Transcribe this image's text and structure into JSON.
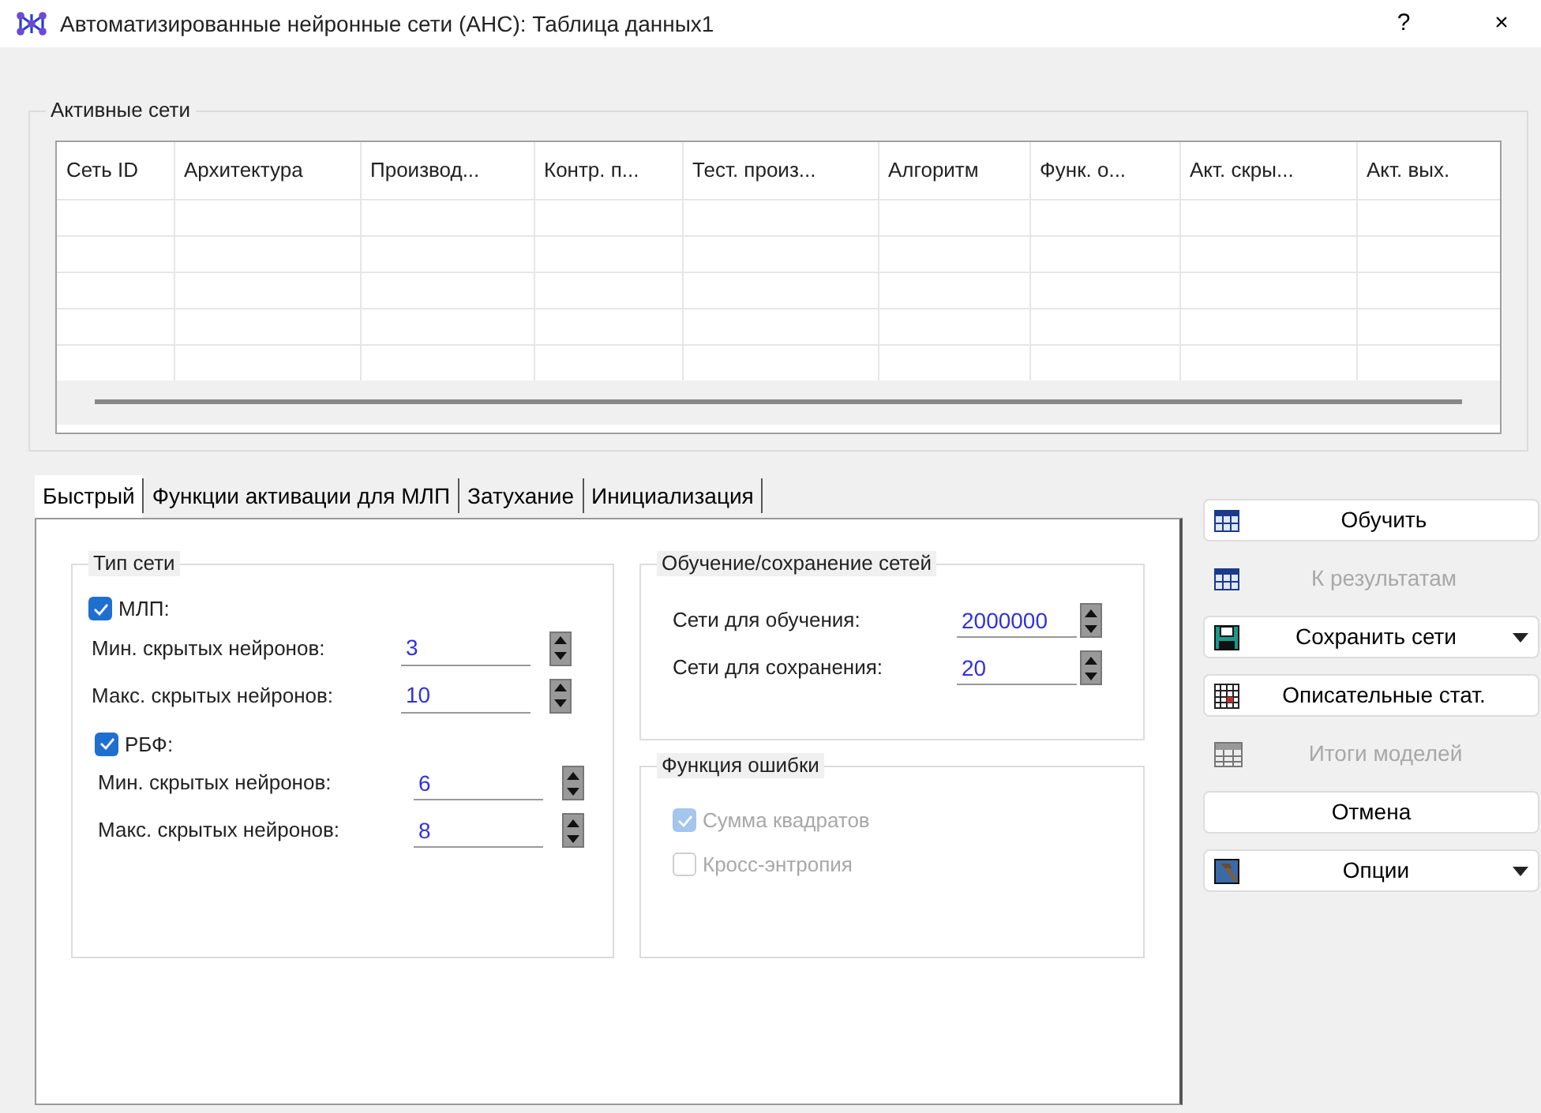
{
  "window": {
    "title": "Автоматизированные нейронные сети (АНС): Таблица данных1",
    "help": "?",
    "close": "×"
  },
  "active_networks": {
    "legend": "Активные сети",
    "columns": [
      "Сеть ID",
      "Архитектура",
      "Производ...",
      "Контр. п...",
      "Тест. произ...",
      "Алгоритм",
      "Функ. о...",
      "Акт. скры...",
      "Акт. вых."
    ]
  },
  "tabs": [
    {
      "label": "Быстрый",
      "selected": true
    },
    {
      "label": "Функции активации для МЛП",
      "selected": false
    },
    {
      "label": "Затухание",
      "selected": false
    },
    {
      "label": "Инициализация",
      "selected": false
    }
  ],
  "network_type": {
    "legend": "Тип сети",
    "groups": [
      {
        "label": "МЛП:",
        "checked": true,
        "fields": [
          {
            "label": "Мин. скрытых нейронов:",
            "value": "3"
          },
          {
            "label": "Макс. скрытых нейронов:",
            "value": "10"
          }
        ]
      },
      {
        "label": "РБФ:",
        "checked": true,
        "fields": [
          {
            "label": "Мин. скрытых нейронов:",
            "value": "6"
          },
          {
            "label": "Макс. скрытых нейронов:",
            "value": "8"
          }
        ]
      }
    ]
  },
  "training": {
    "legend": "Обучение/сохранение сетей",
    "fields": [
      {
        "label": "Сети для обучения:",
        "value": "2000000"
      },
      {
        "label": "Сети для сохранения:",
        "value": "20"
      }
    ]
  },
  "error_function": {
    "legend": "Функция ошибки",
    "disabled": true,
    "options": [
      {
        "label": "Сумма квадратов",
        "checked": true
      },
      {
        "label": "Кросс-энтропия",
        "checked": false
      }
    ]
  },
  "buttons": [
    {
      "label": "Обучить",
      "kind": "grid",
      "disabled": false,
      "dropdown": false
    },
    {
      "label": "К результатам",
      "kind": "grid",
      "disabled": true,
      "dropdown": false
    },
    {
      "label": "Сохранить сети",
      "kind": "disk",
      "disabled": false,
      "dropdown": true
    },
    {
      "label": "Описательные стат.",
      "kind": "table",
      "disabled": false,
      "dropdown": false
    },
    {
      "label": "Итоги моделей",
      "kind": "summary",
      "disabled": true,
      "dropdown": false
    },
    {
      "label": "Отмена",
      "kind": "plain",
      "disabled": false,
      "dropdown": false
    },
    {
      "label": "Опции",
      "kind": "hammer",
      "disabled": false,
      "dropdown": true
    }
  ]
}
